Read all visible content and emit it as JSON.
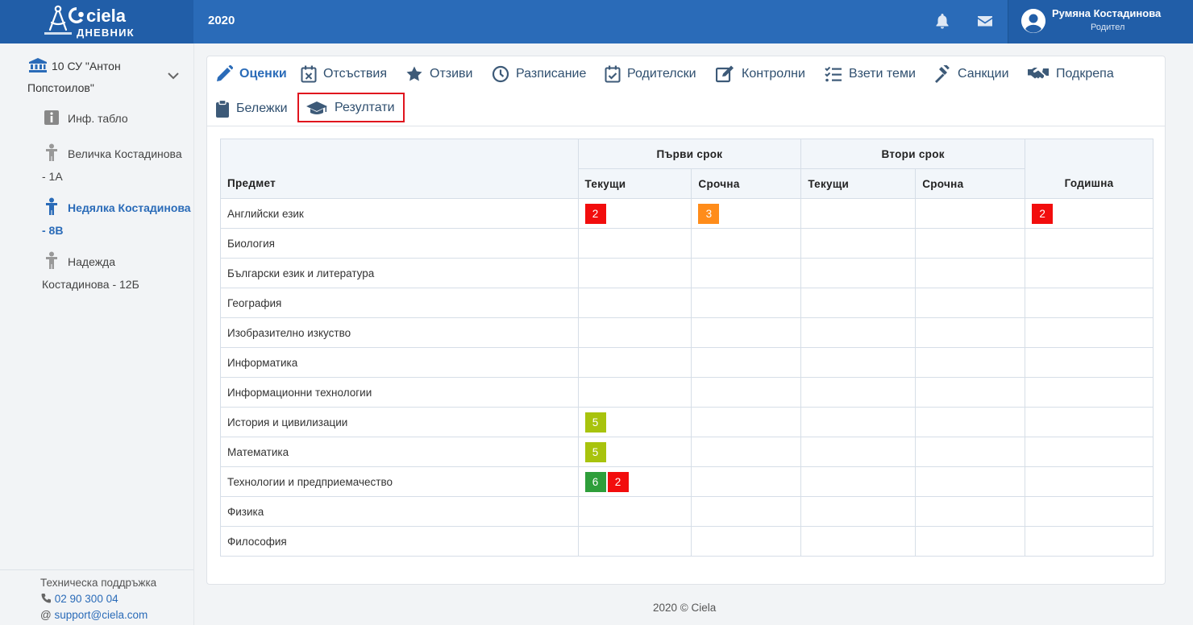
{
  "header": {
    "logo_word": "ciela",
    "logo_sub": "ДНЕВНИК",
    "year": "2020",
    "bell_icon": "bell-icon",
    "mail_icon": "envelope-icon",
    "user_name": "Румяна Костадинова",
    "user_role": "Родител"
  },
  "sidebar": {
    "school_line1": "10 СУ \"Антон",
    "school_line2": "Попстоилов\"",
    "items": [
      {
        "label": "Инф. табло",
        "icon": "info-icon"
      },
      {
        "line1": "Величка Костадинова",
        "line2": "- 1А",
        "icon": "child-icon"
      },
      {
        "line1": "Недялка Костадинова",
        "line2": "- 8В",
        "icon": "child-icon",
        "active": true
      },
      {
        "line1": "Надежда",
        "line2": "Костадинова - 12Б",
        "icon": "child-icon"
      }
    ],
    "support": {
      "title": "Техническа поддръжка",
      "phone": "02 90 300 04",
      "email_prefix": "@",
      "email": "support@ciela.com"
    }
  },
  "tabs": [
    {
      "label": "Оценки",
      "icon": "pencil-icon",
      "active": true
    },
    {
      "label": "Отсъствия",
      "icon": "calendar-x-icon"
    },
    {
      "label": "Отзиви",
      "icon": "star-icon"
    },
    {
      "label": "Разписание",
      "icon": "clock-icon"
    },
    {
      "label": "Родителски",
      "icon": "calendar-check-icon"
    },
    {
      "label": "Контролни",
      "icon": "edit-icon"
    },
    {
      "label": "Взети теми",
      "icon": "tasks-icon"
    },
    {
      "label": "Санкции",
      "icon": "gavel-icon"
    },
    {
      "label": "Подкрепа",
      "icon": "handshake-icon"
    },
    {
      "label": "Бележки",
      "icon": "clipboard-icon"
    },
    {
      "label": "Резултати",
      "icon": "graduation-cap-icon",
      "highlighted": true
    }
  ],
  "table": {
    "subject_header": "Предмет",
    "term1_header": "Първи срок",
    "term2_header": "Втори срок",
    "current_header": "Текущи",
    "final_term_header": "Срочна",
    "annual_header": "Годишна",
    "rows": [
      {
        "subject": "Английски език",
        "t1_current": [
          "2"
        ],
        "t1_final": [
          "3"
        ],
        "t2_current": [],
        "t2_final": [],
        "annual": [
          "2"
        ]
      },
      {
        "subject": "Биология",
        "t1_current": [],
        "t1_final": [],
        "t2_current": [],
        "t2_final": [],
        "annual": []
      },
      {
        "subject": "Български език и литература",
        "t1_current": [],
        "t1_final": [],
        "t2_current": [],
        "t2_final": [],
        "annual": []
      },
      {
        "subject": "География",
        "t1_current": [],
        "t1_final": [],
        "t2_current": [],
        "t2_final": [],
        "annual": []
      },
      {
        "subject": "Изобразително изкуство",
        "t1_current": [],
        "t1_final": [],
        "t2_current": [],
        "t2_final": [],
        "annual": []
      },
      {
        "subject": "Информатика",
        "t1_current": [],
        "t1_final": [],
        "t2_current": [],
        "t2_final": [],
        "annual": []
      },
      {
        "subject": "Информационни технологии",
        "t1_current": [],
        "t1_final": [],
        "t2_current": [],
        "t2_final": [],
        "annual": []
      },
      {
        "subject": "История и цивилизации",
        "t1_current": [
          "5"
        ],
        "t1_final": [],
        "t2_current": [],
        "t2_final": [],
        "annual": []
      },
      {
        "subject": "Математика",
        "t1_current": [
          "5"
        ],
        "t1_final": [],
        "t2_current": [],
        "t2_final": [],
        "annual": []
      },
      {
        "subject": "Технологии и предприемачество",
        "t1_current": [
          "6",
          "2"
        ],
        "t1_final": [],
        "t2_current": [],
        "t2_final": [],
        "annual": []
      },
      {
        "subject": "Физика",
        "t1_current": [],
        "t1_final": [],
        "t2_current": [],
        "t2_final": [],
        "annual": []
      },
      {
        "subject": "Философия",
        "t1_current": [],
        "t1_final": [],
        "t2_current": [],
        "t2_final": [],
        "annual": []
      }
    ]
  },
  "grade_colors": {
    "2": "#f20d0d",
    "3": "#ff8c1a",
    "4": "#f5c400",
    "5": "#a8c30d",
    "6": "#2e9e3a"
  },
  "colors": {
    "primary": "#2a6bb8",
    "highlight_border": "#e0141e"
  },
  "footer": "2020 © Ciela"
}
